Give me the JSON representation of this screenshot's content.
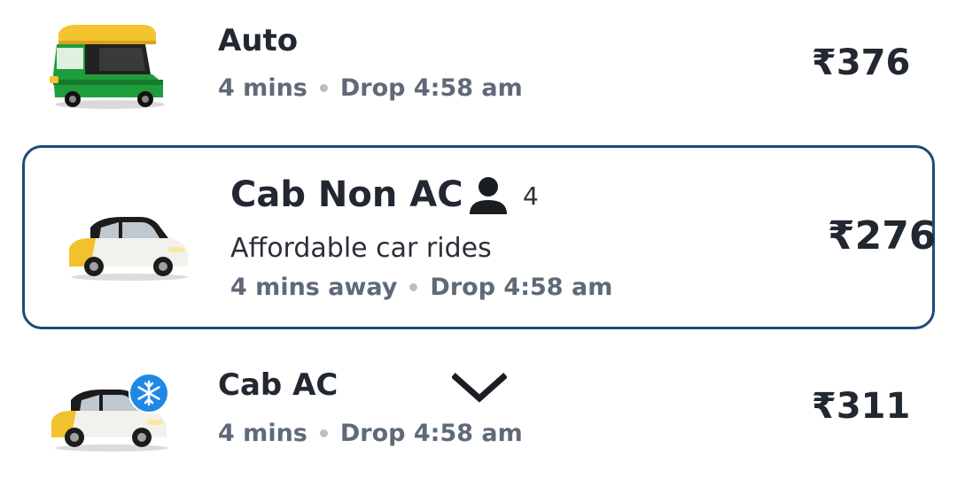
{
  "rides": {
    "auto": {
      "title": "Auto",
      "eta": "4 mins",
      "drop": "Drop 4:58 am",
      "price": "₹376",
      "icon": "auto-rickshaw-icon"
    },
    "cab_non_ac": {
      "title": "Cab Non AC",
      "seats": "4",
      "description": "Affordable car rides",
      "eta": "4 mins away",
      "drop": "Drop 4:58 am",
      "price": "₹276",
      "icon": "cab-icon",
      "selected": true
    },
    "cab_ac": {
      "title": "Cab AC",
      "eta": "4 mins",
      "drop": "Drop 4:58 am",
      "price": "₹311",
      "icon": "cab-ac-icon"
    }
  },
  "colors": {
    "selected_border": "#1f4a7c",
    "secondary_text": "#5f6a78",
    "ac_badge": "#1e88e5"
  }
}
